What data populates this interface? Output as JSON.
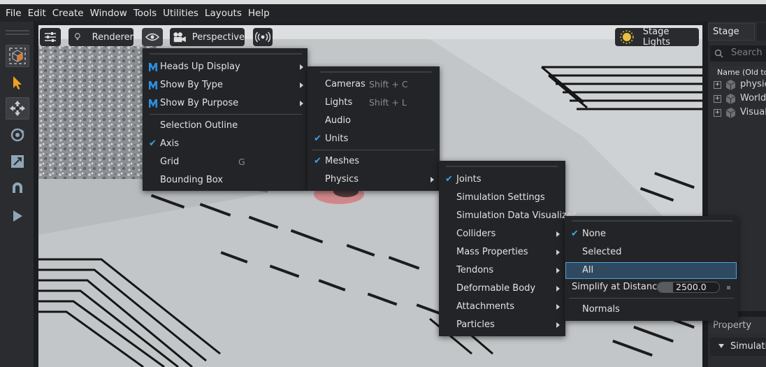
{
  "menubar": {
    "items": [
      "File",
      "Edit",
      "Create",
      "Window",
      "Tools",
      "Utilities",
      "Layouts",
      "Help"
    ]
  },
  "left_toolbar": {
    "tools": [
      "select-icon",
      "pointer-icon",
      "move-icon",
      "rotate-icon",
      "scale-icon",
      "snap-icon",
      "play-icon"
    ]
  },
  "viewport_toolbar": {
    "settings_icon": "sliders-icon",
    "renderer_label": "Renderer",
    "eye_icon": "eye-icon",
    "camera_label": "Perspective",
    "audio_icon": "broadcast-icon",
    "lights_label": "Stage Lights"
  },
  "right_panel": {
    "stage_tab": "Stage",
    "search_placeholder": "Search",
    "column_header": "Name (Old to",
    "tree_items": [
      "physic",
      "World",
      "Visuals"
    ],
    "property_tab": "Property",
    "property_section": "Simulatio"
  },
  "show_menu": {
    "items": [
      {
        "label": "Heads Up Display",
        "logo": true,
        "submenu": true
      },
      {
        "label": "Show By Type",
        "logo": true,
        "submenu": true
      },
      {
        "label": "Show By Purpose",
        "logo": true,
        "submenu": true
      },
      {
        "label": "Selection Outline"
      },
      {
        "label": "Axis",
        "checked": true
      },
      {
        "label": "Grid",
        "shortcut": "G"
      },
      {
        "label": "Bounding Box"
      }
    ]
  },
  "type_menu": {
    "items": [
      {
        "label": "Cameras",
        "shortcut": "Shift + C"
      },
      {
        "label": "Lights",
        "shortcut": "Shift + L"
      },
      {
        "label": "Audio"
      },
      {
        "label": "Units",
        "checked": true
      },
      {
        "label": "Meshes",
        "checked": true
      },
      {
        "label": "Physics",
        "submenu": true
      }
    ]
  },
  "physics_menu": {
    "items": [
      {
        "label": "Joints",
        "checked": true
      },
      {
        "label": "Simulation Settings"
      },
      {
        "label": "Simulation Data Visualizer"
      },
      {
        "label": "Colliders",
        "submenu": true
      },
      {
        "label": "Mass Properties",
        "submenu": true
      },
      {
        "label": "Tendons",
        "submenu": true
      },
      {
        "label": "Deformable Body",
        "submenu": true
      },
      {
        "label": "Attachments",
        "submenu": true
      },
      {
        "label": "Particles",
        "submenu": true
      }
    ]
  },
  "colliders_menu": {
    "items": [
      {
        "label": "None",
        "checked": true
      },
      {
        "label": "Selected"
      },
      {
        "label": "All",
        "highlighted": true
      }
    ],
    "simplify_label": "Simplify at Distance",
    "simplify_value": "2500.0",
    "normals_label": "Normals"
  },
  "colors": {
    "accent": "#3fa2e6",
    "highlight_bg": "#2f4a60",
    "highlight_border": "#4aa0d8",
    "menu_bg": "#232427",
    "logo_blue": "#2d8fe0"
  }
}
